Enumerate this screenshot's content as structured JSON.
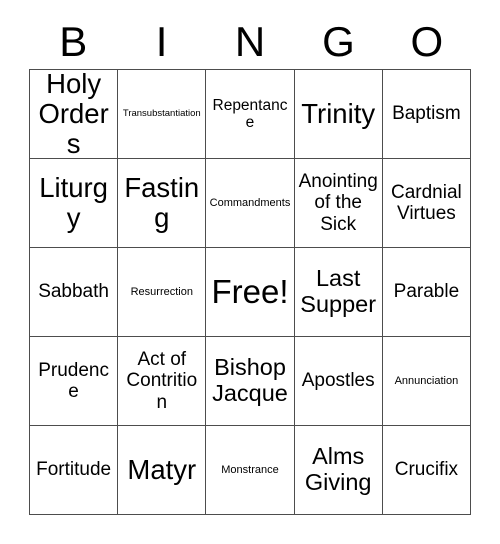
{
  "card": {
    "title": "BINGO",
    "header_letters": [
      "B",
      "I",
      "N",
      "G",
      "O"
    ],
    "grid_size": "5x5",
    "free_space": "Free!",
    "colors": {
      "background": "#ffffff",
      "text": "#000000",
      "border": "#4d4d4d"
    },
    "rows": [
      [
        {
          "label": "Holy Orders",
          "size": "xxl",
          "free": false
        },
        {
          "label": "Transubstantiation",
          "size": "xs",
          "free": false
        },
        {
          "label": "Repentance",
          "size": "m",
          "free": false
        },
        {
          "label": "Trinity",
          "size": "xxl",
          "free": false
        },
        {
          "label": "Baptism",
          "size": "l",
          "free": false
        }
      ],
      [
        {
          "label": "Liturgy",
          "size": "xxl",
          "free": false
        },
        {
          "label": "Fasting",
          "size": "xxl",
          "free": false
        },
        {
          "label": "Commandments",
          "size": "s",
          "free": false
        },
        {
          "label": "Anointing of the Sick",
          "size": "l",
          "free": false
        },
        {
          "label": "Cardnial Virtues",
          "size": "l",
          "free": false
        }
      ],
      [
        {
          "label": "Sabbath",
          "size": "l",
          "free": false
        },
        {
          "label": "Resurrection",
          "size": "s",
          "free": false
        },
        {
          "label": "Free!",
          "size": "free",
          "free": true
        },
        {
          "label": "Last Supper",
          "size": "xl",
          "free": false
        },
        {
          "label": "Parable",
          "size": "l",
          "free": false
        }
      ],
      [
        {
          "label": "Prudence",
          "size": "l",
          "free": false
        },
        {
          "label": "Act of Contrition",
          "size": "l",
          "free": false
        },
        {
          "label": "Bishop Jacque",
          "size": "xl",
          "free": false
        },
        {
          "label": "Apostles",
          "size": "l",
          "free": false
        },
        {
          "label": "Annunciation",
          "size": "s",
          "free": false
        }
      ],
      [
        {
          "label": "Fortitude",
          "size": "l",
          "free": false
        },
        {
          "label": "Matyr",
          "size": "xxl",
          "free": false
        },
        {
          "label": "Monstrance",
          "size": "s",
          "free": false
        },
        {
          "label": "Alms Giving",
          "size": "xl",
          "free": false
        },
        {
          "label": "Crucifix",
          "size": "l",
          "free": false
        }
      ]
    ]
  }
}
